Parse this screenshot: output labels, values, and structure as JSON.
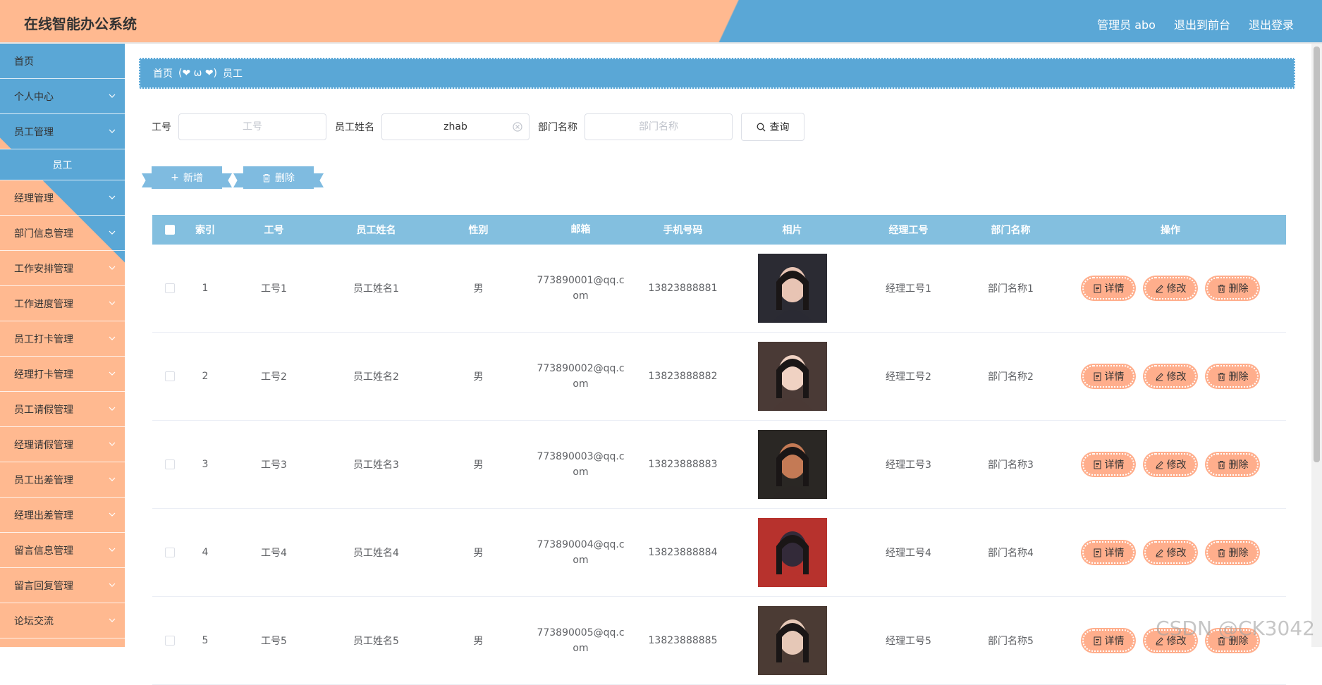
{
  "header": {
    "title": "在线智能办公系统",
    "user": "管理员 abo",
    "back_front": "退出到前台",
    "logout": "退出登录"
  },
  "sidebar": {
    "items": [
      {
        "label": "首页"
      },
      {
        "label": "个人中心"
      },
      {
        "label": "员工管理"
      },
      {
        "label": "员工"
      },
      {
        "label": "经理管理"
      },
      {
        "label": "部门信息管理"
      },
      {
        "label": "工作安排管理"
      },
      {
        "label": "工作进度管理"
      },
      {
        "label": "员工打卡管理"
      },
      {
        "label": "经理打卡管理"
      },
      {
        "label": "员工请假管理"
      },
      {
        "label": "经理请假管理"
      },
      {
        "label": "员工出差管理"
      },
      {
        "label": "经理出差管理"
      },
      {
        "label": "留言信息管理"
      },
      {
        "label": "留言回复管理"
      },
      {
        "label": "论坛交流"
      }
    ]
  },
  "breadcrumb": {
    "home": "首页",
    "separator": "(❤ ω ❤)",
    "current": "员工"
  },
  "search": {
    "no_label": "工号",
    "no_placeholder": "工号",
    "no_value": "",
    "name_label": "员工姓名",
    "name_placeholder": "员工姓名",
    "name_value": "zhab",
    "dept_label": "部门名称",
    "dept_placeholder": "部门名称",
    "dept_value": "",
    "query_label": "查询"
  },
  "actions": {
    "add_label": "新增",
    "delete_label": "删除"
  },
  "table": {
    "headers": [
      "索引",
      "工号",
      "员工姓名",
      "性别",
      "邮箱",
      "手机号码",
      "相片",
      "经理工号",
      "部门名称",
      "操作"
    ],
    "ops": {
      "detail": "详情",
      "edit": "修改",
      "delete": "删除"
    },
    "rows": [
      {
        "idx": "1",
        "no": "工号1",
        "name": "员工姓名1",
        "sex": "男",
        "email": "773890001@qq.com",
        "phone": "13823888881",
        "mgr": "经理工号1",
        "dept": "部门名称1"
      },
      {
        "idx": "2",
        "no": "工号2",
        "name": "员工姓名2",
        "sex": "男",
        "email": "773890002@qq.com",
        "phone": "13823888882",
        "mgr": "经理工号2",
        "dept": "部门名称2"
      },
      {
        "idx": "3",
        "no": "工号3",
        "name": "员工姓名3",
        "sex": "男",
        "email": "773890003@qq.com",
        "phone": "13823888883",
        "mgr": "经理工号3",
        "dept": "部门名称3"
      },
      {
        "idx": "4",
        "no": "工号4",
        "name": "员工姓名4",
        "sex": "男",
        "email": "773890004@qq.com",
        "phone": "13823888884",
        "mgr": "经理工号4",
        "dept": "部门名称4"
      },
      {
        "idx": "5",
        "no": "工号5",
        "name": "员工姓名5",
        "sex": "男",
        "email": "773890005@qq.com",
        "phone": "13823888885",
        "mgr": "经理工号5",
        "dept": "部门名称5"
      }
    ]
  },
  "watermark": "CSDN @CK3042",
  "colors": {
    "peach": "#ffb990",
    "blue": "#5aa7d6",
    "table_head": "#83bfdf",
    "op_button": "#ffae8c"
  }
}
